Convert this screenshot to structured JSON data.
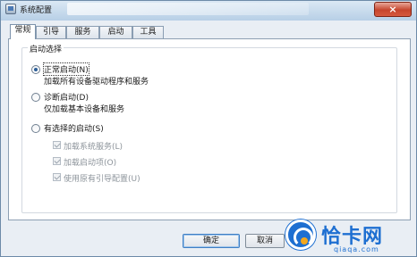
{
  "window": {
    "title": "系统配置",
    "close_glyph": "×"
  },
  "tabs": [
    {
      "label": "常规",
      "active": true
    },
    {
      "label": "引导",
      "active": false
    },
    {
      "label": "服务",
      "active": false
    },
    {
      "label": "启动",
      "active": false
    },
    {
      "label": "工具",
      "active": false
    }
  ],
  "startup": {
    "group_title": "启动选择",
    "options": [
      {
        "label": "正常启动(N)",
        "description": "加载所有设备驱动程序和服务",
        "checked": true
      },
      {
        "label": "诊断启动(D)",
        "description": "仅加载基本设备和服务",
        "checked": false
      },
      {
        "label": "有选择的启动(S)",
        "description": "",
        "checked": false
      }
    ],
    "selective_items": [
      {
        "label": "加载系统服务(L)",
        "checked": true,
        "enabled": false
      },
      {
        "label": "加载启动项(O)",
        "checked": true,
        "enabled": false
      },
      {
        "label": "使用原有引导配置(U)",
        "checked": true,
        "enabled": false
      }
    ]
  },
  "buttons": {
    "ok": "确定",
    "cancel": "取消"
  },
  "watermark": {
    "brand": "恰卡网",
    "url": "qiaqa.com"
  }
}
